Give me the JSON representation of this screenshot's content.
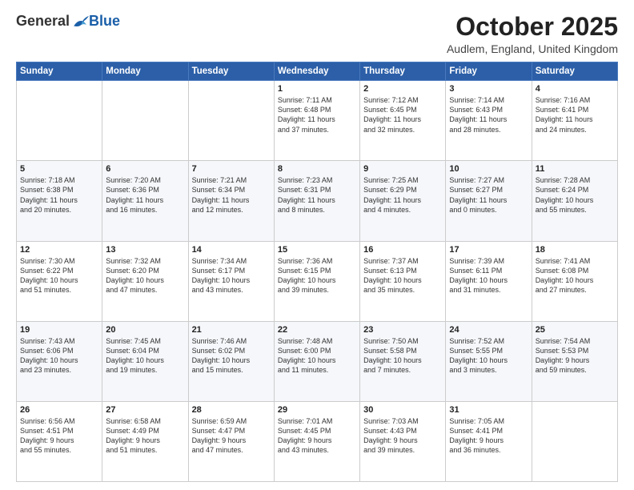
{
  "header": {
    "logo_general": "General",
    "logo_blue": "Blue",
    "month": "October 2025",
    "location": "Audlem, England, United Kingdom"
  },
  "days_of_week": [
    "Sunday",
    "Monday",
    "Tuesday",
    "Wednesday",
    "Thursday",
    "Friday",
    "Saturday"
  ],
  "weeks": [
    [
      {
        "day": "",
        "text": ""
      },
      {
        "day": "",
        "text": ""
      },
      {
        "day": "",
        "text": ""
      },
      {
        "day": "1",
        "text": "Sunrise: 7:11 AM\nSunset: 6:48 PM\nDaylight: 11 hours\nand 37 minutes."
      },
      {
        "day": "2",
        "text": "Sunrise: 7:12 AM\nSunset: 6:45 PM\nDaylight: 11 hours\nand 32 minutes."
      },
      {
        "day": "3",
        "text": "Sunrise: 7:14 AM\nSunset: 6:43 PM\nDaylight: 11 hours\nand 28 minutes."
      },
      {
        "day": "4",
        "text": "Sunrise: 7:16 AM\nSunset: 6:41 PM\nDaylight: 11 hours\nand 24 minutes."
      }
    ],
    [
      {
        "day": "5",
        "text": "Sunrise: 7:18 AM\nSunset: 6:38 PM\nDaylight: 11 hours\nand 20 minutes."
      },
      {
        "day": "6",
        "text": "Sunrise: 7:20 AM\nSunset: 6:36 PM\nDaylight: 11 hours\nand 16 minutes."
      },
      {
        "day": "7",
        "text": "Sunrise: 7:21 AM\nSunset: 6:34 PM\nDaylight: 11 hours\nand 12 minutes."
      },
      {
        "day": "8",
        "text": "Sunrise: 7:23 AM\nSunset: 6:31 PM\nDaylight: 11 hours\nand 8 minutes."
      },
      {
        "day": "9",
        "text": "Sunrise: 7:25 AM\nSunset: 6:29 PM\nDaylight: 11 hours\nand 4 minutes."
      },
      {
        "day": "10",
        "text": "Sunrise: 7:27 AM\nSunset: 6:27 PM\nDaylight: 11 hours\nand 0 minutes."
      },
      {
        "day": "11",
        "text": "Sunrise: 7:28 AM\nSunset: 6:24 PM\nDaylight: 10 hours\nand 55 minutes."
      }
    ],
    [
      {
        "day": "12",
        "text": "Sunrise: 7:30 AM\nSunset: 6:22 PM\nDaylight: 10 hours\nand 51 minutes."
      },
      {
        "day": "13",
        "text": "Sunrise: 7:32 AM\nSunset: 6:20 PM\nDaylight: 10 hours\nand 47 minutes."
      },
      {
        "day": "14",
        "text": "Sunrise: 7:34 AM\nSunset: 6:17 PM\nDaylight: 10 hours\nand 43 minutes."
      },
      {
        "day": "15",
        "text": "Sunrise: 7:36 AM\nSunset: 6:15 PM\nDaylight: 10 hours\nand 39 minutes."
      },
      {
        "day": "16",
        "text": "Sunrise: 7:37 AM\nSunset: 6:13 PM\nDaylight: 10 hours\nand 35 minutes."
      },
      {
        "day": "17",
        "text": "Sunrise: 7:39 AM\nSunset: 6:11 PM\nDaylight: 10 hours\nand 31 minutes."
      },
      {
        "day": "18",
        "text": "Sunrise: 7:41 AM\nSunset: 6:08 PM\nDaylight: 10 hours\nand 27 minutes."
      }
    ],
    [
      {
        "day": "19",
        "text": "Sunrise: 7:43 AM\nSunset: 6:06 PM\nDaylight: 10 hours\nand 23 minutes."
      },
      {
        "day": "20",
        "text": "Sunrise: 7:45 AM\nSunset: 6:04 PM\nDaylight: 10 hours\nand 19 minutes."
      },
      {
        "day": "21",
        "text": "Sunrise: 7:46 AM\nSunset: 6:02 PM\nDaylight: 10 hours\nand 15 minutes."
      },
      {
        "day": "22",
        "text": "Sunrise: 7:48 AM\nSunset: 6:00 PM\nDaylight: 10 hours\nand 11 minutes."
      },
      {
        "day": "23",
        "text": "Sunrise: 7:50 AM\nSunset: 5:58 PM\nDaylight: 10 hours\nand 7 minutes."
      },
      {
        "day": "24",
        "text": "Sunrise: 7:52 AM\nSunset: 5:55 PM\nDaylight: 10 hours\nand 3 minutes."
      },
      {
        "day": "25",
        "text": "Sunrise: 7:54 AM\nSunset: 5:53 PM\nDaylight: 9 hours\nand 59 minutes."
      }
    ],
    [
      {
        "day": "26",
        "text": "Sunrise: 6:56 AM\nSunset: 4:51 PM\nDaylight: 9 hours\nand 55 minutes."
      },
      {
        "day": "27",
        "text": "Sunrise: 6:58 AM\nSunset: 4:49 PM\nDaylight: 9 hours\nand 51 minutes."
      },
      {
        "day": "28",
        "text": "Sunrise: 6:59 AM\nSunset: 4:47 PM\nDaylight: 9 hours\nand 47 minutes."
      },
      {
        "day": "29",
        "text": "Sunrise: 7:01 AM\nSunset: 4:45 PM\nDaylight: 9 hours\nand 43 minutes."
      },
      {
        "day": "30",
        "text": "Sunrise: 7:03 AM\nSunset: 4:43 PM\nDaylight: 9 hours\nand 39 minutes."
      },
      {
        "day": "31",
        "text": "Sunrise: 7:05 AM\nSunset: 4:41 PM\nDaylight: 9 hours\nand 36 minutes."
      },
      {
        "day": "",
        "text": ""
      }
    ]
  ]
}
